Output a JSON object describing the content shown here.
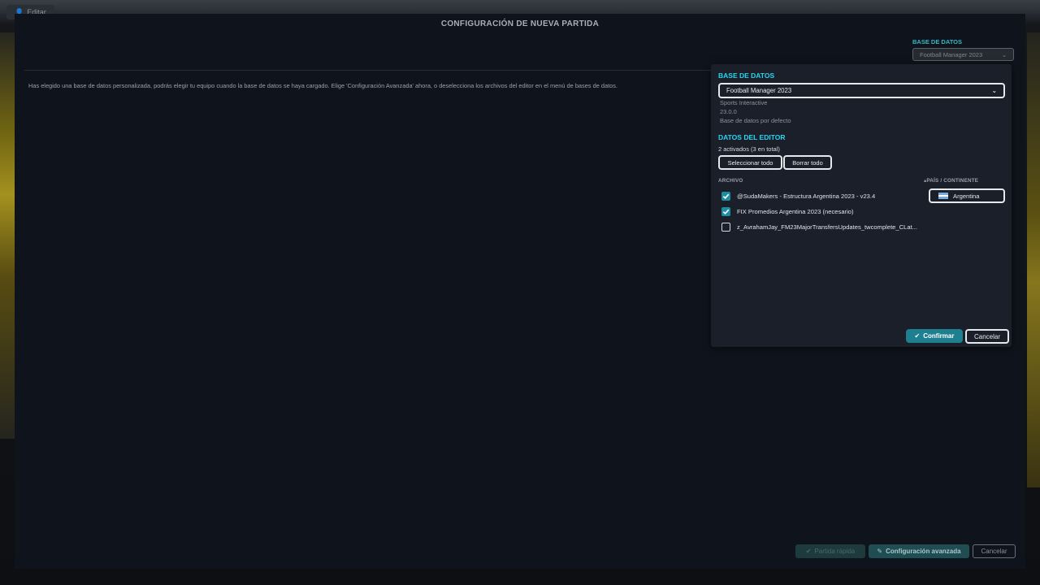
{
  "topbar": {
    "edit_label": "Editar"
  },
  "panel": {
    "title": "CONFIGURACIÓN DE NUEVA PARTIDA",
    "info_text": "Has elegido una base de datos personalizada, podrás elegir tu equipo cuando la base de datos se haya cargado. Elige 'Configuración Avanzada' ahora, o deselecciona los archivos del editor en el menú de bases de datos.",
    "db_label": "BASE DE DATOS",
    "db_selected": "Football Manager 2023",
    "buttons": {
      "quick": "Partida rápida",
      "advanced": "Configuración avanzada",
      "cancel": "Cancelar"
    }
  },
  "popup": {
    "db_heading": "BASE DE DATOS",
    "db_selected": "Football Manager 2023",
    "db_publisher": "Sports Interactive",
    "db_version": "23.0.0",
    "db_desc": "Base de datos por defecto",
    "editor_heading": "DATOS DEL EDITOR",
    "editor_count": "2 activados (3 en total)",
    "select_all": "Seleccionar todo",
    "clear_all": "Borrar todo",
    "col_file": "ARCHIVO",
    "col_country": "PAÍS / CONTINENTE",
    "files": [
      {
        "name": "@SudaMakers - Estructura Argentina 2023 - v23.4",
        "checked": true,
        "country": "Argentina"
      },
      {
        "name": "FIX Promedios Argentina 2023 (necesario)",
        "checked": true,
        "country": ""
      },
      {
        "name": "z_AvrahamJay_FM23MajorTransfersUpdates_twcomplete_CLat...",
        "checked": false,
        "country": ""
      }
    ],
    "confirm": "Confirmar",
    "cancel": "Cancelar"
  },
  "colors": {
    "accent": "#27d6ee",
    "checkbox": "#1d8ea0",
    "confirm": "#1d7f8f"
  }
}
